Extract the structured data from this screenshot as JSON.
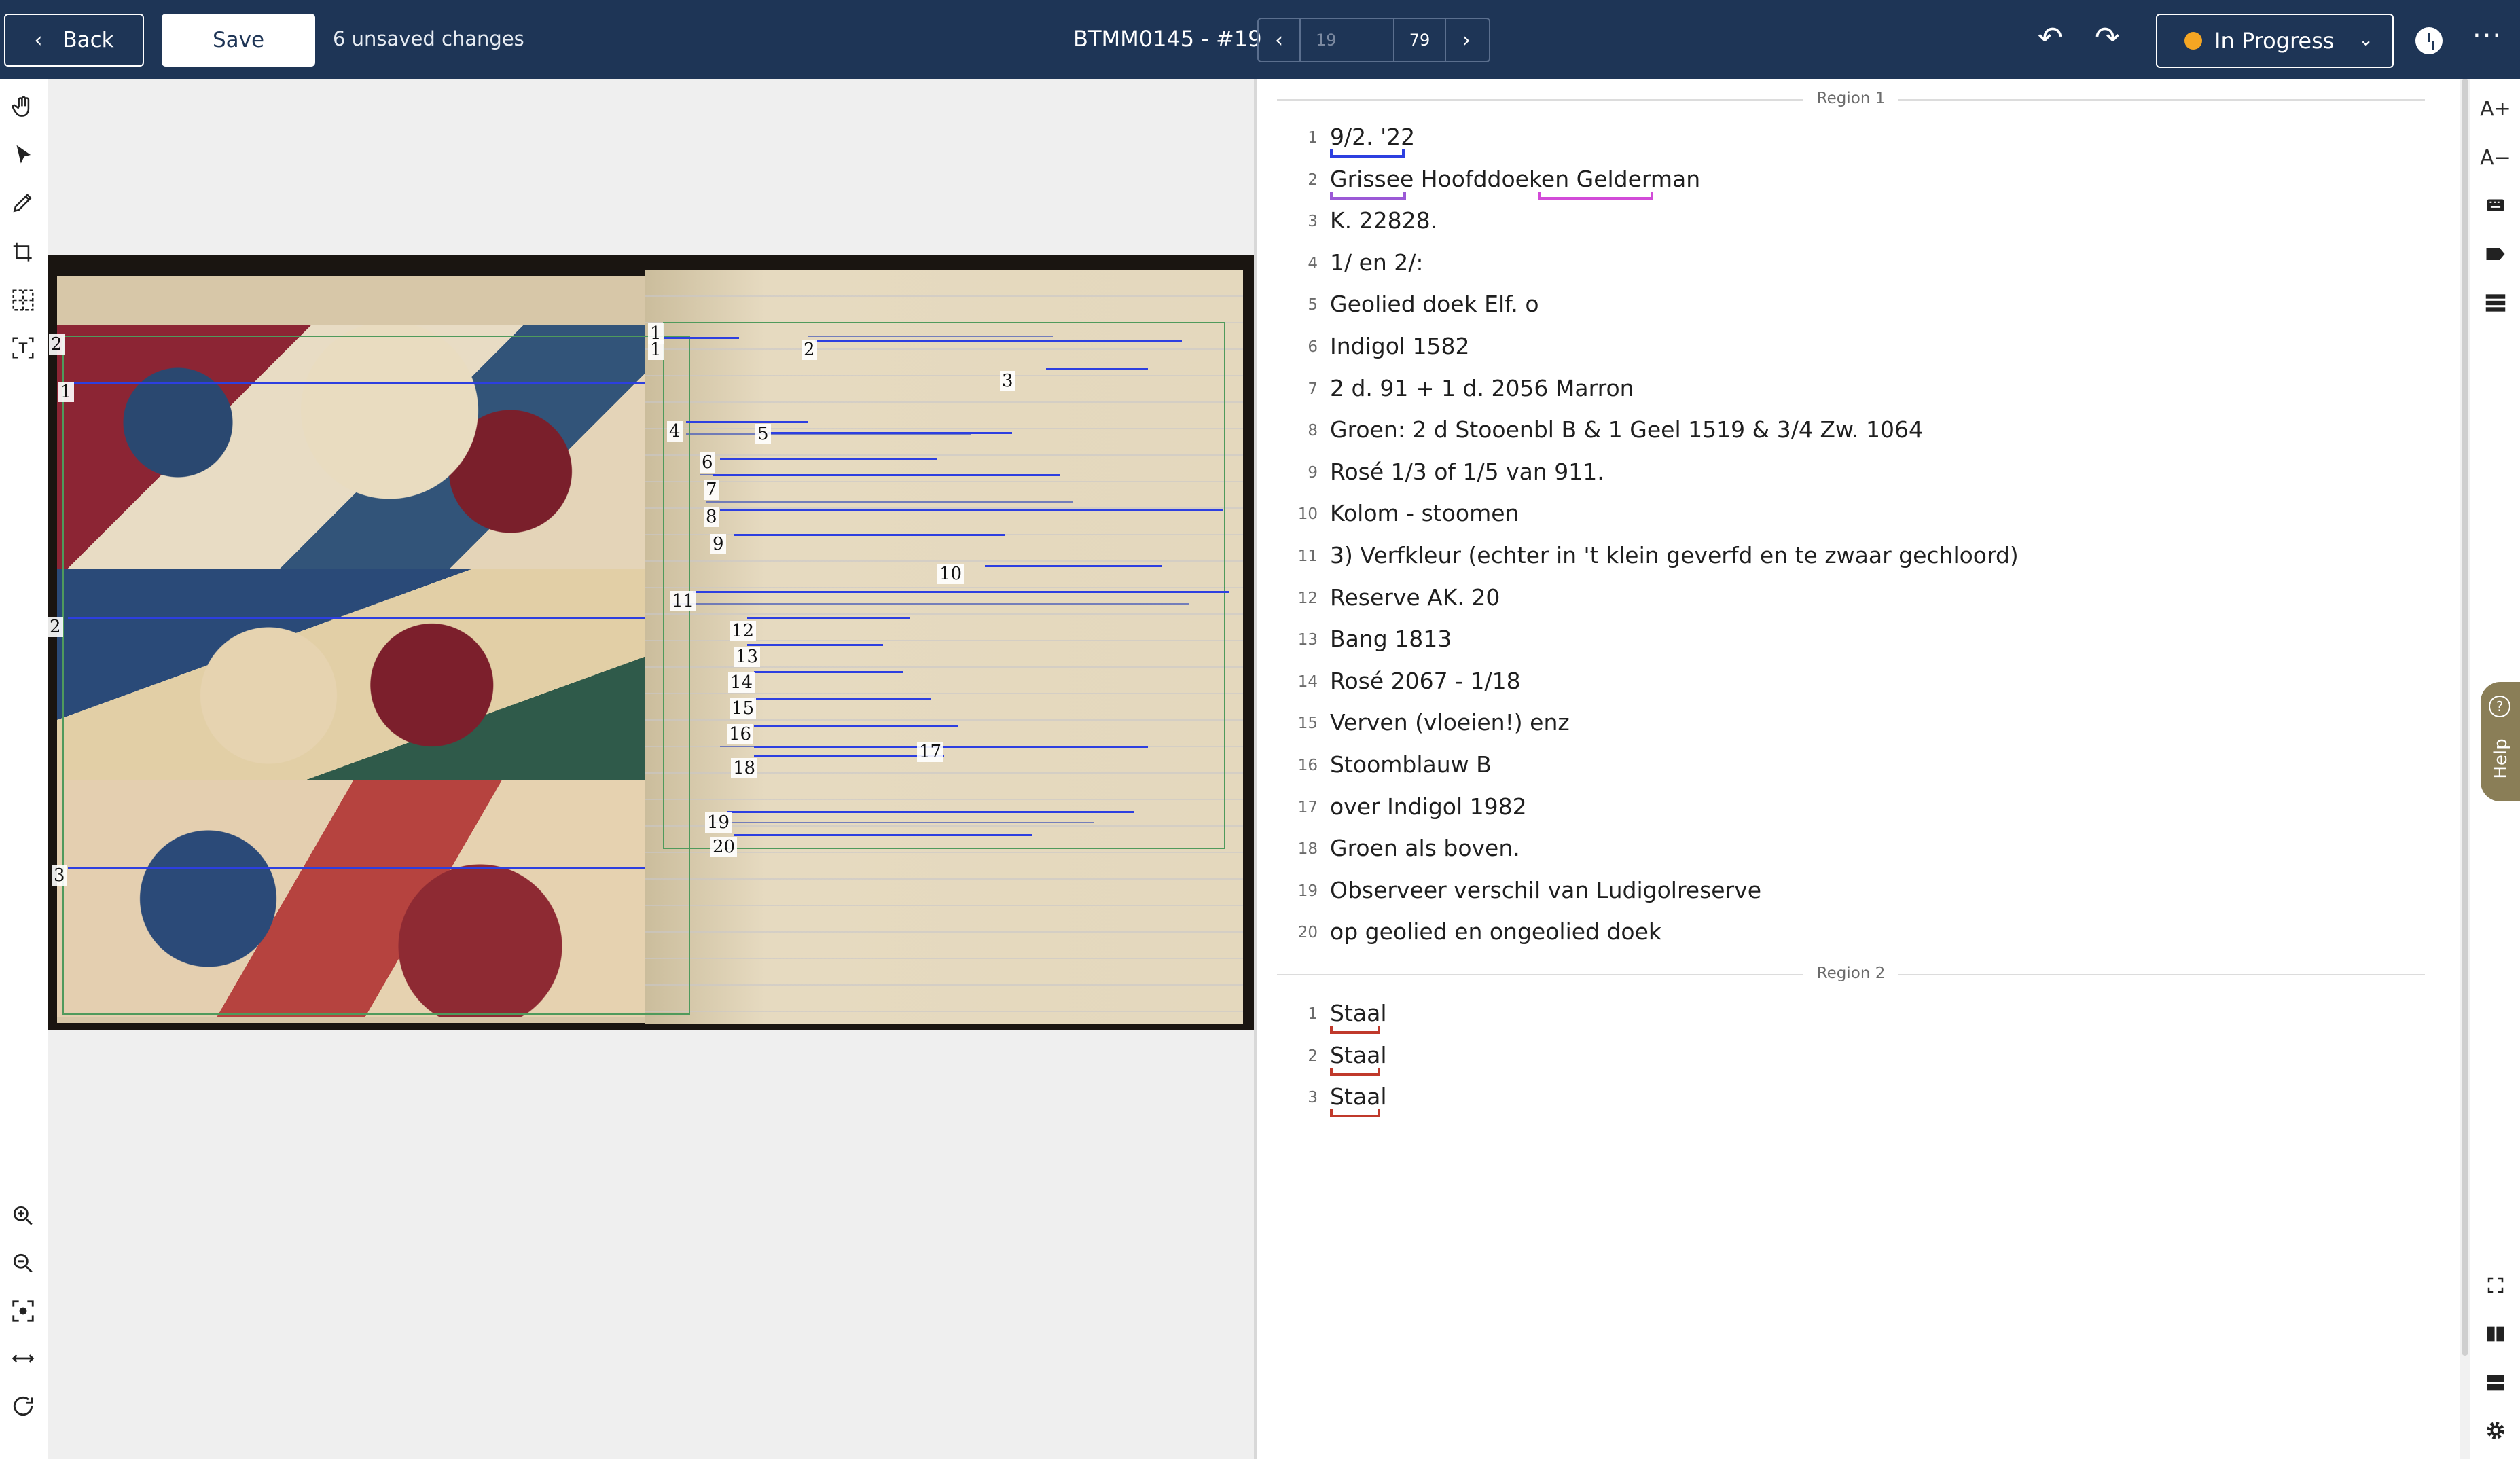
{
  "topbar": {
    "back_label": "Back",
    "save_label": "Save",
    "unsaved_text": "6 unsaved changes",
    "doc_title": "BTMM0145 - #19",
    "pager_placeholder": "19",
    "pager_total": "79",
    "status_label": "In Progress",
    "status_color": "#f5a623",
    "more_label": "···"
  },
  "icons": {
    "hand": "hand-icon",
    "select": "cursor-icon",
    "pen": "pen-icon",
    "crop": "crop-icon",
    "split": "split-icon",
    "text": "text-tool-icon",
    "zoom_in": "zoom-in-icon",
    "zoom_out": "zoom-out-icon",
    "fit": "fit-icon",
    "fit_width": "fit-width-icon",
    "rotate": "rotate-icon"
  },
  "right_toolbar": {
    "font_up": "A+",
    "font_down": "A−"
  },
  "viewer_labels": {
    "left": [
      "2",
      "1",
      "2",
      "3"
    ],
    "right": [
      "1",
      "1",
      "2",
      "3",
      "4",
      "5",
      "6",
      "7",
      "8",
      "9",
      "10",
      "11",
      "12",
      "13",
      "14",
      "15",
      "16",
      "17",
      "18",
      "19",
      "20"
    ]
  },
  "transcription": {
    "region1_label": "Region 1",
    "region2_label": "Region 2",
    "region1_lines": [
      "9/2. '22",
      "Grissee Hoofddoeken Gelderman",
      "K. 22828.",
      "1/ en 2/:",
      "Geolied doek Elf. o",
      "Indigol 1582",
      "2 d. 91 + 1 d. 2056 Marron",
      "Groen: 2 d Stooenbl B & 1 Geel 1519 & 3/4 Zw. 1064",
      "Rosé 1/3 of 1/5 van 911.",
      "Kolom - stoomen",
      "3) Verfkleur (echter in 't klein geverfd en te zwaar gechloord)",
      "Reserve AK. 20",
      "Bang 1813",
      "Rosé 2067 - 1/18",
      "Verven (vloeien!) enz",
      "Stoomblauw B",
      "over Indigol 1982",
      "Groen als boven.",
      "Observeer verschil van Ludigolreserve",
      "op geolied en ongeolied doek"
    ],
    "region2_lines": [
      "Staal",
      "Staal",
      "Staal"
    ]
  },
  "help_label": "Help",
  "colors": {
    "topbar": "#1e3556",
    "underline_blue": "#2d3fe0",
    "underline_purple": "#9b59d6",
    "underline_magenta": "#d24bd8",
    "underline_red": "#c0392b"
  }
}
